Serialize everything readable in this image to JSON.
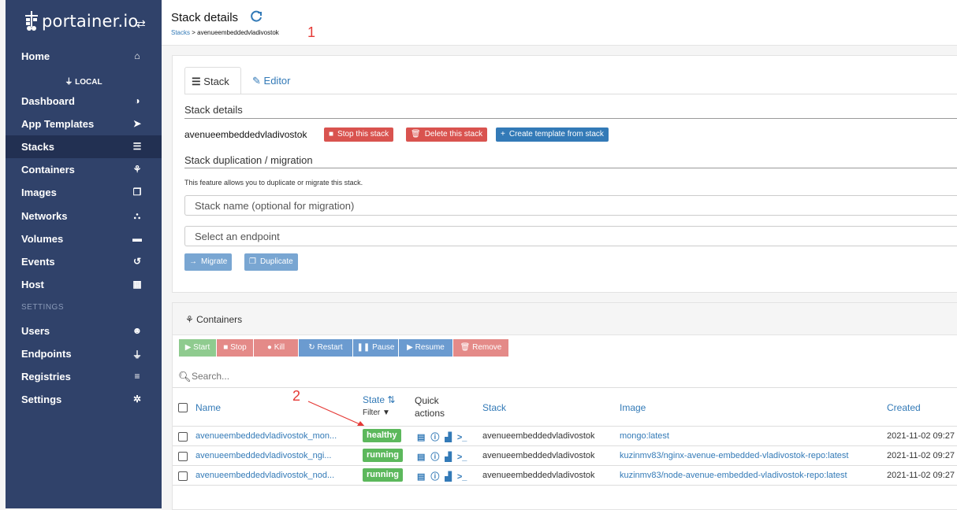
{
  "sidebar": {
    "brand": "portainer.io",
    "environment": "LOCAL",
    "items": [
      {
        "label": "Home",
        "icon": "home-icon",
        "glyph": "⌂"
      },
      {
        "label": "Dashboard",
        "icon": "tachometer-icon",
        "glyph": "◑"
      },
      {
        "label": "App Templates",
        "icon": "rocket-icon",
        "glyph": "➤"
      },
      {
        "label": "Stacks",
        "icon": "th-list-icon",
        "glyph": "☰"
      },
      {
        "label": "Containers",
        "icon": "cubes-icon",
        "glyph": "⚘"
      },
      {
        "label": "Images",
        "icon": "clone-icon",
        "glyph": "❐"
      },
      {
        "label": "Networks",
        "icon": "sitemap-icon",
        "glyph": "⛬"
      },
      {
        "label": "Volumes",
        "icon": "hdd-icon",
        "glyph": "▬"
      },
      {
        "label": "Events",
        "icon": "history-icon",
        "glyph": "↺"
      },
      {
        "label": "Host",
        "icon": "th-icon",
        "glyph": "▦"
      }
    ],
    "settings_section": "SETTINGS",
    "settings_items": [
      {
        "label": "Users",
        "icon": "users-icon",
        "glyph": "☻"
      },
      {
        "label": "Endpoints",
        "icon": "plug-icon",
        "glyph": "⏚"
      },
      {
        "label": "Registries",
        "icon": "database-icon",
        "glyph": "≡"
      },
      {
        "label": "Settings",
        "icon": "cogs-icon",
        "glyph": "✲"
      }
    ]
  },
  "header": {
    "title": "Stack details",
    "breadcrumb_link": "Stacks",
    "breadcrumb_sep": ">",
    "breadcrumb_current": "avenueembeddedvladivostok",
    "annotation_1": "1"
  },
  "stack_panel": {
    "tabs": {
      "stack": "Stack",
      "editor": "Editor"
    },
    "details_title": "Stack details",
    "stack_name": "avenueembeddedvladivostok",
    "stop_label": "Stop this stack",
    "delete_label": "Delete this stack",
    "create_template_label": "Create template from stack",
    "duplication_title": "Stack duplication / migration",
    "duplication_help": "This feature allows you to duplicate or migrate this stack.",
    "name_placeholder": "Stack name (optional for migration)",
    "endpoint_placeholder": "Select an endpoint",
    "migrate_label": "Migrate",
    "duplicate_label": "Duplicate"
  },
  "containers_panel": {
    "title": "Containers",
    "actions": {
      "start": "Start",
      "stop": "Stop",
      "kill": "Kill",
      "restart": "Restart",
      "pause": "Pause",
      "resume": "Resume",
      "remove": "Remove"
    },
    "search_placeholder": "Search...",
    "annotation_2": "2",
    "columns": {
      "name": "Name",
      "state": "State",
      "state_filter": "Filter",
      "quick_actions_1": "Quick",
      "quick_actions_2": "actions",
      "stack": "Stack",
      "image": "Image",
      "created": "Created"
    },
    "rows": [
      {
        "name": "avenueembeddedvladivostok_mon...",
        "state": "healthy",
        "stack": "avenueembeddedvladivostok",
        "image": "mongo:latest",
        "created": "2021-11-02 09:27"
      },
      {
        "name": "avenueembeddedvladivostok_ngi...",
        "state": "running",
        "stack": "avenueembeddedvladivostok",
        "image": "kuzinmv83/nginx-avenue-embedded-vladivostok-repo:latest",
        "created": "2021-11-02 09:27"
      },
      {
        "name": "avenueembeddedvladivostok_nod...",
        "state": "running",
        "stack": "avenueembeddedvladivostok",
        "image": "kuzinmv83/node-avenue-embedded-vladivostok-repo:latest",
        "created": "2021-11-02 09:27"
      }
    ]
  },
  "colors": {
    "sidebar_bg": "#30426a",
    "sidebar_active": "#223052",
    "link": "#337ab7",
    "danger": "#d9534f",
    "success": "#5cb85c",
    "annotation": "#e53935"
  }
}
